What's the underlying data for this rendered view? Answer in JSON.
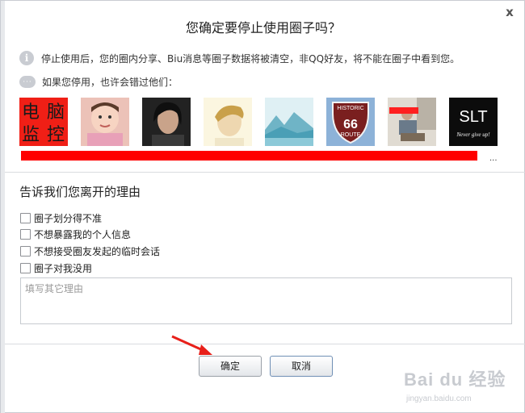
{
  "dialog": {
    "title": "您确定要停止使用圈子吗？",
    "close_glyph": "x"
  },
  "info": {
    "warning_text": "停止使用后，您的圈内分享、Biu消息等圈子数据将被清空，非QQ好友，将不能在圈子中看到您。",
    "miss_text": "如果您停用，也许会错过他们：",
    "info_icon_glyph": "i",
    "chat_icon_glyph": "···"
  },
  "friends": {
    "avatar1_text": [
      "电",
      "脑",
      "监",
      "控"
    ],
    "avatar7_label": "HISTORIC",
    "avatar7_route_number": "66",
    "avatar7_route": "ROUTE",
    "avatar8_text": "SLT",
    "avatar8_sub": "Never give up!",
    "more": "..."
  },
  "reasons": {
    "title": "告诉我们您离开的理由",
    "items": [
      "圈子划分得不准",
      "不想暴露我的个人信息",
      "不想接受圈友发起的临时会话",
      "圈子对我没用"
    ],
    "other_placeholder": "填写其它理由"
  },
  "buttons": {
    "confirm": "确定",
    "cancel": "取消"
  },
  "watermark": {
    "brand": "Bai du 经验",
    "url": "jingyan.baidu.com"
  },
  "colors": {
    "redbar": "#ff0000",
    "arrow": "#e8201a"
  }
}
